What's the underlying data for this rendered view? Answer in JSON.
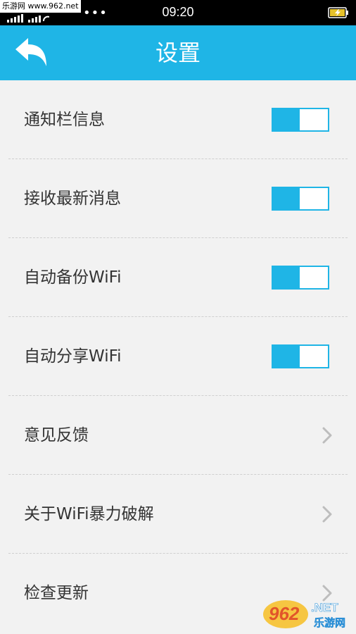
{
  "status_bar": {
    "watermark_text": "乐游网 www.962.net",
    "time": "09:20",
    "dots": "•••",
    "signal_icon": "signal-bars-icon",
    "battery_icon": "battery-charging-icon"
  },
  "header": {
    "title": "设置",
    "back_icon": "back-arrow-icon"
  },
  "settings": {
    "items": [
      {
        "label": "通知栏信息",
        "control": "toggle",
        "on": true
      },
      {
        "label": "接收最新消息",
        "control": "toggle",
        "on": true
      },
      {
        "label": "自动备份WiFi",
        "control": "toggle",
        "on": true
      },
      {
        "label": "自动分享WiFi",
        "control": "toggle",
        "on": true
      },
      {
        "label": "意见反馈",
        "control": "chevron"
      },
      {
        "label": "关于WiFi暴力破解",
        "control": "chevron"
      },
      {
        "label": "检查更新",
        "control": "chevron"
      }
    ]
  },
  "watermark_logo": {
    "text": "962.NET",
    "subtext": "乐游网"
  },
  "colors": {
    "accent": "#1fb5e6",
    "background": "#f2f2f2",
    "status_bar": "#000000",
    "label_text": "#333333"
  }
}
